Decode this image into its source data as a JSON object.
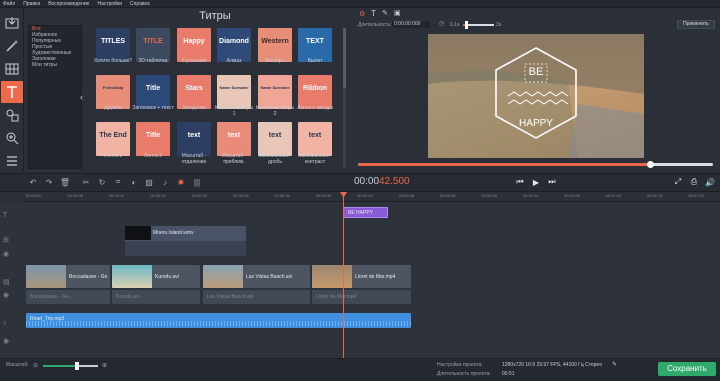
{
  "menu": [
    "Файл",
    "Правка",
    "Воспроизведение",
    "Настройки",
    "Справка"
  ],
  "titles_panel": {
    "header": "Титры",
    "categories": [
      {
        "label": "Все",
        "selected": true
      },
      {
        "label": "Избранное",
        "selected": false
      },
      {
        "label": "Популярные",
        "selected": false
      },
      {
        "label": "Простые",
        "selected": false
      },
      {
        "label": "Художественные",
        "selected": false
      },
      {
        "label": "Заголовки",
        "selected": false
      },
      {
        "label": "Мои титры",
        "selected": false
      }
    ],
    "tiles": [
      {
        "label": "Хотите больше?",
        "art": "TITLES"
      },
      {
        "label": "3D-табличка",
        "art": "TITLE"
      },
      {
        "label": "6-угольник",
        "art": "Happy"
      },
      {
        "label": "Алмаз",
        "art": "Diamond"
      },
      {
        "label": "Вестерн",
        "art": "Western"
      },
      {
        "label": "Вылет",
        "art": "TEXT"
      },
      {
        "label": "Дружба",
        "art": "Friendship"
      },
      {
        "label": "Заголовок + текст",
        "art": "Title"
      },
      {
        "label": "Звездочки",
        "art": "Stars"
      },
      {
        "label": "Конечные титры 1",
        "art": "Name Surname"
      },
      {
        "label": "Конечные титры 2",
        "art": "Name Surname"
      },
      {
        "label": "Лента + звезды",
        "art": "Ribbon"
      },
      {
        "label": "Лента 1",
        "art": "The End"
      },
      {
        "label": "Лента 2",
        "art": "Title"
      },
      {
        "label": "Масштаб - отдаление",
        "art": "text"
      },
      {
        "label": "Масштаб - приближ.",
        "art": "text"
      },
      {
        "label": "Минимализм - дробь",
        "art": "text"
      },
      {
        "label": "Минимализм - контраст",
        "art": "text"
      }
    ]
  },
  "properties": {
    "duration_label": "Длительность:",
    "duration_value": "0:00:00:000",
    "speed_value": "0.1s",
    "speed_max": "3s",
    "apply_button": "Применить"
  },
  "preview": {
    "line1": "BE",
    "line2": "HAPPY",
    "progress": 0.82
  },
  "timecode": {
    "prefix": "00:00",
    "highlight": "42.500"
  },
  "ruler": [
    "00:00:00",
    "00:00:05",
    "00:00:10",
    "00:00:15",
    "00:00:20",
    "00:00:25",
    "00:00:30",
    "00:00:35",
    "00:00:40",
    "00:00:45",
    "00:00:50",
    "00:00:55",
    "00:01:00",
    "00:01:05",
    "00:01:10",
    "00:01:15",
    "00:01:20"
  ],
  "timeline": {
    "title_clip": "BE HAPPY",
    "overlay_clip": "Moeru Island.wmv",
    "video_clips": [
      "Boccadasse - Ge",
      "Kuredu.avi",
      "Las Vistas Beach.avi",
      "Lloret de Mar.mp4"
    ],
    "audio_clips": [
      "Boccadasse - Ge...",
      "Kuredu.avi",
      "Las Vistas Beach.avi",
      "Lloret de Mar.mp4"
    ],
    "music_clip": "Road_Trip.mp3"
  },
  "status": {
    "zoom_label": "Масштаб:",
    "settings_label": "Настройки проекта:",
    "settings_value": "1280x720 16:9 29.97 FPS, 44100 Гц Стерео",
    "duration_label": "Длительность проекта:",
    "duration_value": "00:51",
    "save_button": "Сохранить"
  },
  "colors": {
    "accent": "#ed6b4a",
    "save": "#2eaa6a",
    "music": "#3f8fe0",
    "title_clip": "#8a5bd6"
  }
}
